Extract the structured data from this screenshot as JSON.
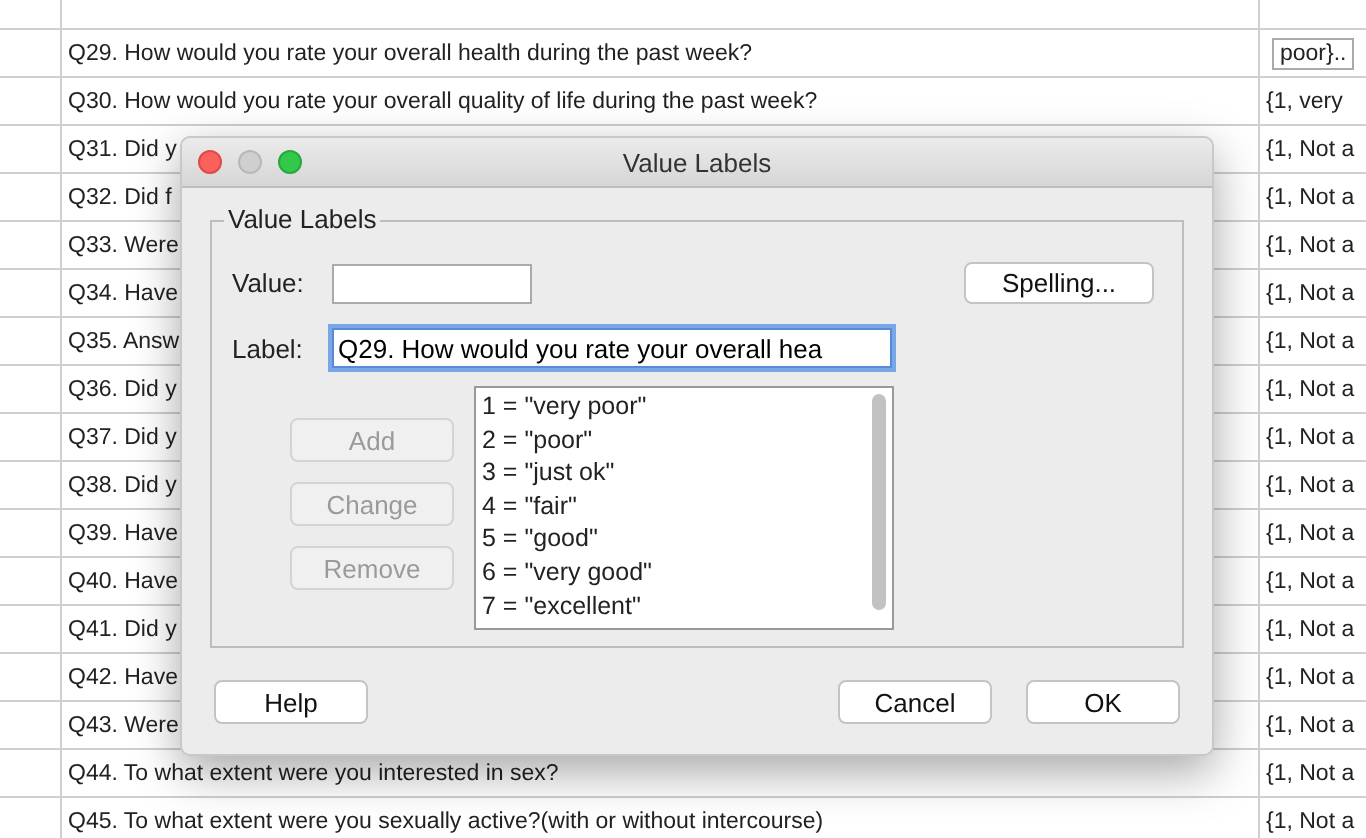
{
  "table": {
    "rows": [
      {
        "label": "Q29. How would you rate your overall health during the past week?",
        "value": "poor}..",
        "editing": true
      },
      {
        "label": "Q30. How would you rate your overall quality of life during the past week?",
        "value": "{1, very",
        "editing": false
      },
      {
        "label": "Q31. Did y",
        "value": "{1, Not a",
        "editing": false
      },
      {
        "label": "Q32. Did f",
        "value": "{1, Not a",
        "editing": false
      },
      {
        "label": "Q33. Were",
        "value": "{1, Not a",
        "editing": false
      },
      {
        "label": "Q34. Have",
        "value": "{1, Not a",
        "editing": false
      },
      {
        "label": "Q35. Answ",
        "value": "{1, Not a",
        "editing": false
      },
      {
        "label": "Q36. Did y",
        "value": "{1, Not a",
        "editing": false
      },
      {
        "label": "Q37. Did y",
        "value": "{1, Not a",
        "editing": false
      },
      {
        "label": "Q38. Did y",
        "value": "{1, Not a",
        "editing": false
      },
      {
        "label": "Q39. Have",
        "value": "{1, Not a",
        "editing": false
      },
      {
        "label": "Q40. Have",
        "value": "{1, Not a",
        "editing": false
      },
      {
        "label": "Q41. Did y",
        "value": "{1, Not a",
        "editing": false
      },
      {
        "label": "Q42. Have",
        "value": "{1, Not a",
        "editing": false
      },
      {
        "label": "Q43. Were",
        "value": "{1, Not a",
        "editing": false
      },
      {
        "label": "Q44. To what extent were you interested in sex?",
        "value": "{1, Not a",
        "editing": false
      },
      {
        "label": "Q45. To what extent were you sexually active?(with or without intercourse)",
        "value": "{1, Not a",
        "editing": false
      }
    ]
  },
  "dialog": {
    "title": "Value Labels",
    "group_title": "Value Labels",
    "value_field": {
      "label": "Value:"
    },
    "spelling_button": "Spelling...",
    "label_field": {
      "label": "Label:",
      "value": "Q29. How would you rate your overall hea",
      "focused": true
    },
    "edit_buttons": [
      {
        "label": "Add",
        "disabled": true
      },
      {
        "label": "Change",
        "disabled": true
      },
      {
        "label": "Remove",
        "disabled": true
      }
    ],
    "value_labels": [
      "1 = \"very poor\"",
      "2 = \"poor\"",
      "3 = \"just ok\"",
      "4 = \"fair\"",
      "5 = \"good\"",
      "6 = \"very good\"",
      "7 = \"excellent\""
    ],
    "footer_buttons": [
      {
        "label": "Help"
      },
      {
        "label": "Cancel"
      },
      {
        "label": "OK"
      }
    ]
  }
}
